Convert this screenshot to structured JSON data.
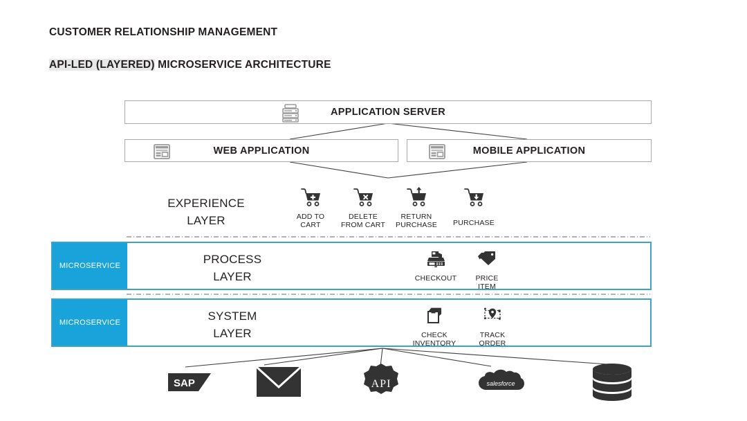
{
  "titles": {
    "line1": "CUSTOMER RELATIONSHIP MANAGEMENT",
    "line2_highlight": "API-LED (LAYERED)",
    "line2_rest": " MICROSERVICE ARCHITECTURE"
  },
  "top_boxes": {
    "app_server": {
      "label": "APPLICATION SERVER",
      "icon": "server-rack-icon"
    },
    "web_app": {
      "label": "WEB APPLICATION",
      "icon": "browser-window-icon"
    },
    "mobile_app": {
      "label": "MOBILE APPLICATION",
      "icon": "browser-window-icon"
    }
  },
  "experience_layer": {
    "name_line1": "EXPERIENCE",
    "name_line2": "LAYER",
    "items": [
      {
        "label": "ADD TO\nCART",
        "icon": "cart-plus-icon"
      },
      {
        "label": "DELETE\nFROM CART",
        "icon": "cart-remove-icon"
      },
      {
        "label": "RETURN\nPURCHASE",
        "icon": "cart-up-arrow-icon"
      },
      {
        "label": "PURCHASE",
        "icon": "cart-down-arrow-icon"
      }
    ]
  },
  "process_layer": {
    "tag": "MICROSERVICE",
    "name_line1": "PROCESS",
    "name_line2": "LAYER",
    "items": [
      {
        "label": "CHECKOUT",
        "icon": "cash-register-icon"
      },
      {
        "label": "PRICE\nITEM",
        "icon": "price-tags-icon"
      }
    ]
  },
  "system_layer": {
    "tag": "MICROSERVICE",
    "name_line1": "SYSTEM",
    "name_line2": "LAYER",
    "items": [
      {
        "label": "CHECK\nINVENTORY",
        "icon": "open-box-icon"
      },
      {
        "label": "TRACK\nORDER",
        "icon": "map-pin-route-icon"
      }
    ]
  },
  "backends": [
    {
      "name": "sap-logo",
      "label": "SAP"
    },
    {
      "name": "email-envelope-icon",
      "label": ""
    },
    {
      "name": "api-gear-icon",
      "label": "API"
    },
    {
      "name": "salesforce-cloud-logo",
      "label": "salesforce"
    },
    {
      "name": "database-cylinder-icon",
      "label": ""
    }
  ],
  "colors": {
    "microservice_tag_bg": "#19a3db",
    "layer_border": "#3ba3c6",
    "box_border": "#a9a9a9",
    "text": "#231f20",
    "icon_dark": "#333333",
    "icon_gray": "#9a9a9a"
  }
}
